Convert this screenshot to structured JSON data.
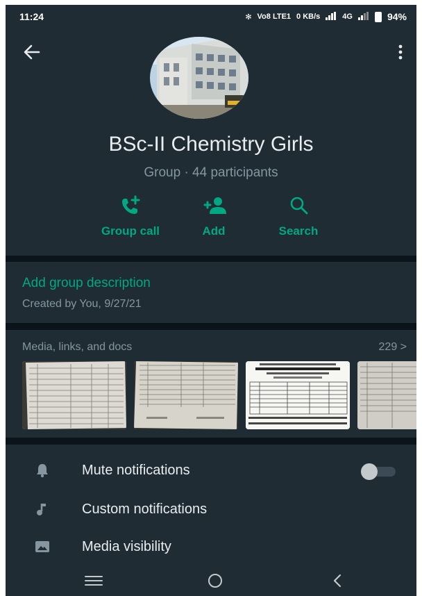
{
  "status_bar": {
    "time": "11:24",
    "bt": "✻",
    "volte": "Vo8 LTE1",
    "speed": "0 KB/s",
    "network": "4G",
    "battery": "94%"
  },
  "header": {
    "back_icon": "arrow-left-icon",
    "more_icon": "more-vertical-icon",
    "group_name": "BSc-II Chemistry Girls",
    "subtitle": "Group · 44 participants",
    "actions": [
      {
        "label": "Group call",
        "icon": "group-call-icon"
      },
      {
        "label": "Add",
        "icon": "add-person-icon"
      },
      {
        "label": "Search",
        "icon": "search-icon"
      }
    ]
  },
  "description": {
    "add_label": "Add group description",
    "created": "Created by You, 9/27/21"
  },
  "media": {
    "title": "Media, links, and docs",
    "count": "229 >"
  },
  "settings": [
    {
      "label": "Mute notifications",
      "icon": "bell-icon"
    },
    {
      "label": "Custom notifications",
      "icon": "music-note-icon"
    },
    {
      "label": "Media visibility",
      "icon": "image-icon"
    }
  ],
  "colors": {
    "accent": "#00a884",
    "background": "#0b141a",
    "panel": "#1f2c34",
    "text_primary": "#e9edef",
    "text_secondary": "#8696a0"
  }
}
